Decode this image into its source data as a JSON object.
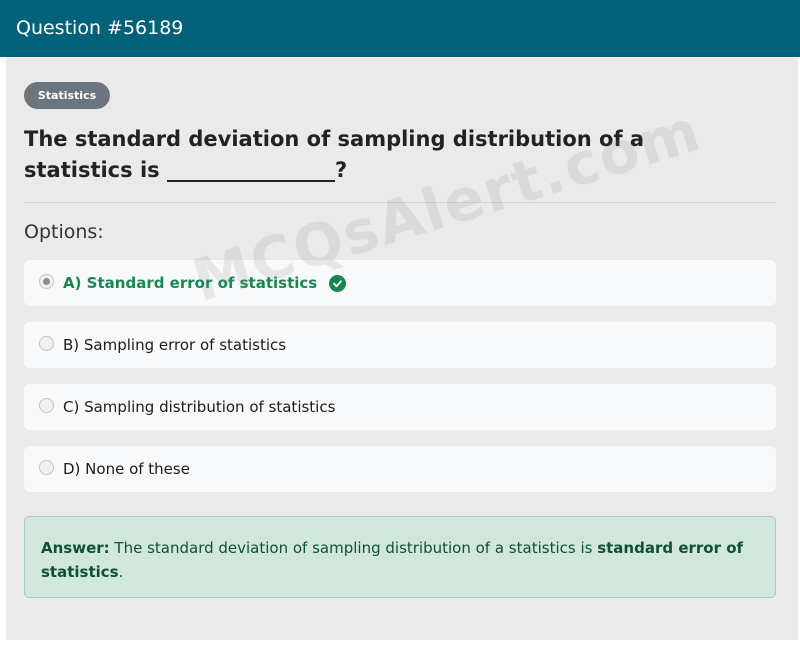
{
  "header": {
    "title": "Question #56189"
  },
  "category": {
    "badge": "Statistics"
  },
  "question": {
    "text": "The standard deviation of sampling distribution of a statistics is ________________?"
  },
  "options_title": "Options:",
  "options": [
    {
      "label": "A) Standard error of statistics",
      "selected": true,
      "correct": true
    },
    {
      "label": "B) Sampling error of statistics",
      "selected": false,
      "correct": false
    },
    {
      "label": "C) Sampling distribution of statistics",
      "selected": false,
      "correct": false
    },
    {
      "label": "D) None of these",
      "selected": false,
      "correct": false
    }
  ],
  "answer": {
    "prefix": "Answer:",
    "text": " The standard deviation of sampling distribution of a statistics is ",
    "bold": "standard error of statistics",
    "suffix": "."
  },
  "watermark": "MCQsAlert.com",
  "colors": {
    "header": "#03627a",
    "correct": "#198754",
    "answer_bg": "#d1e7dd"
  }
}
